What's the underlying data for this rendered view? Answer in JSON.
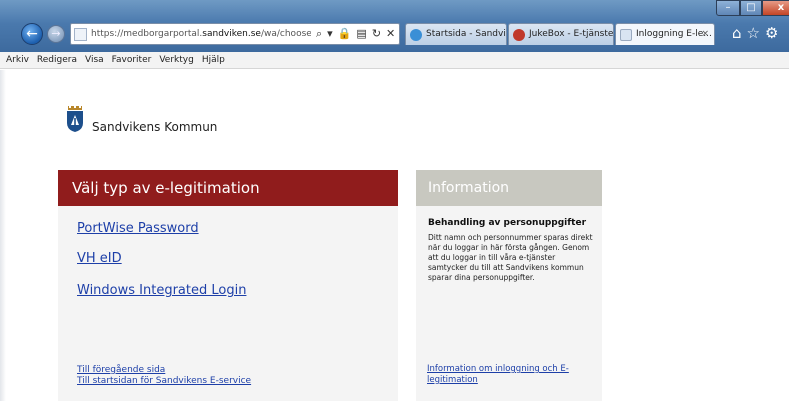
{
  "browser": {
    "url_prefix": "https://medborgarportal.",
    "url_domain": "sandviken.se",
    "url_path": "/wa/chooseAuthm",
    "tabs": [
      {
        "label": "Startsida - Sandvik...",
        "icon_color": "#3a8fd6"
      },
      {
        "label": "JukeBox - E-tjänste...",
        "icon_color": "#c0392b"
      },
      {
        "label": "Inloggning E-le...",
        "icon_color": "#d9e4f2"
      }
    ],
    "tab_close": "×"
  },
  "menu": {
    "items": [
      "Arkiv",
      "Redigera",
      "Visa",
      "Favoriter",
      "Verktyg",
      "Hjälp"
    ]
  },
  "header": {
    "brand": "Sandvikens Kommun",
    "brand_color": "#1d4f8c"
  },
  "auth": {
    "title": "Välj typ av e-legitimation",
    "accent_color": "#901c1c",
    "options": [
      "PortWise Password",
      "VH eID",
      "Windows Integrated Login"
    ],
    "footer_links": [
      "Till föregående sida",
      "Till startsidan för Sandvikens E-service"
    ]
  },
  "info": {
    "title": "Information",
    "subtitle": "Behandling av personuppgifter",
    "body": "Ditt namn och personnummer sparas direkt när du loggar in här första gången. Genom att du loggar in till våra e-tjänster samtycker du till att Sandvikens kommun sparar dina personuppgifter.",
    "link": "Information om inloggning och E-legitimation"
  }
}
